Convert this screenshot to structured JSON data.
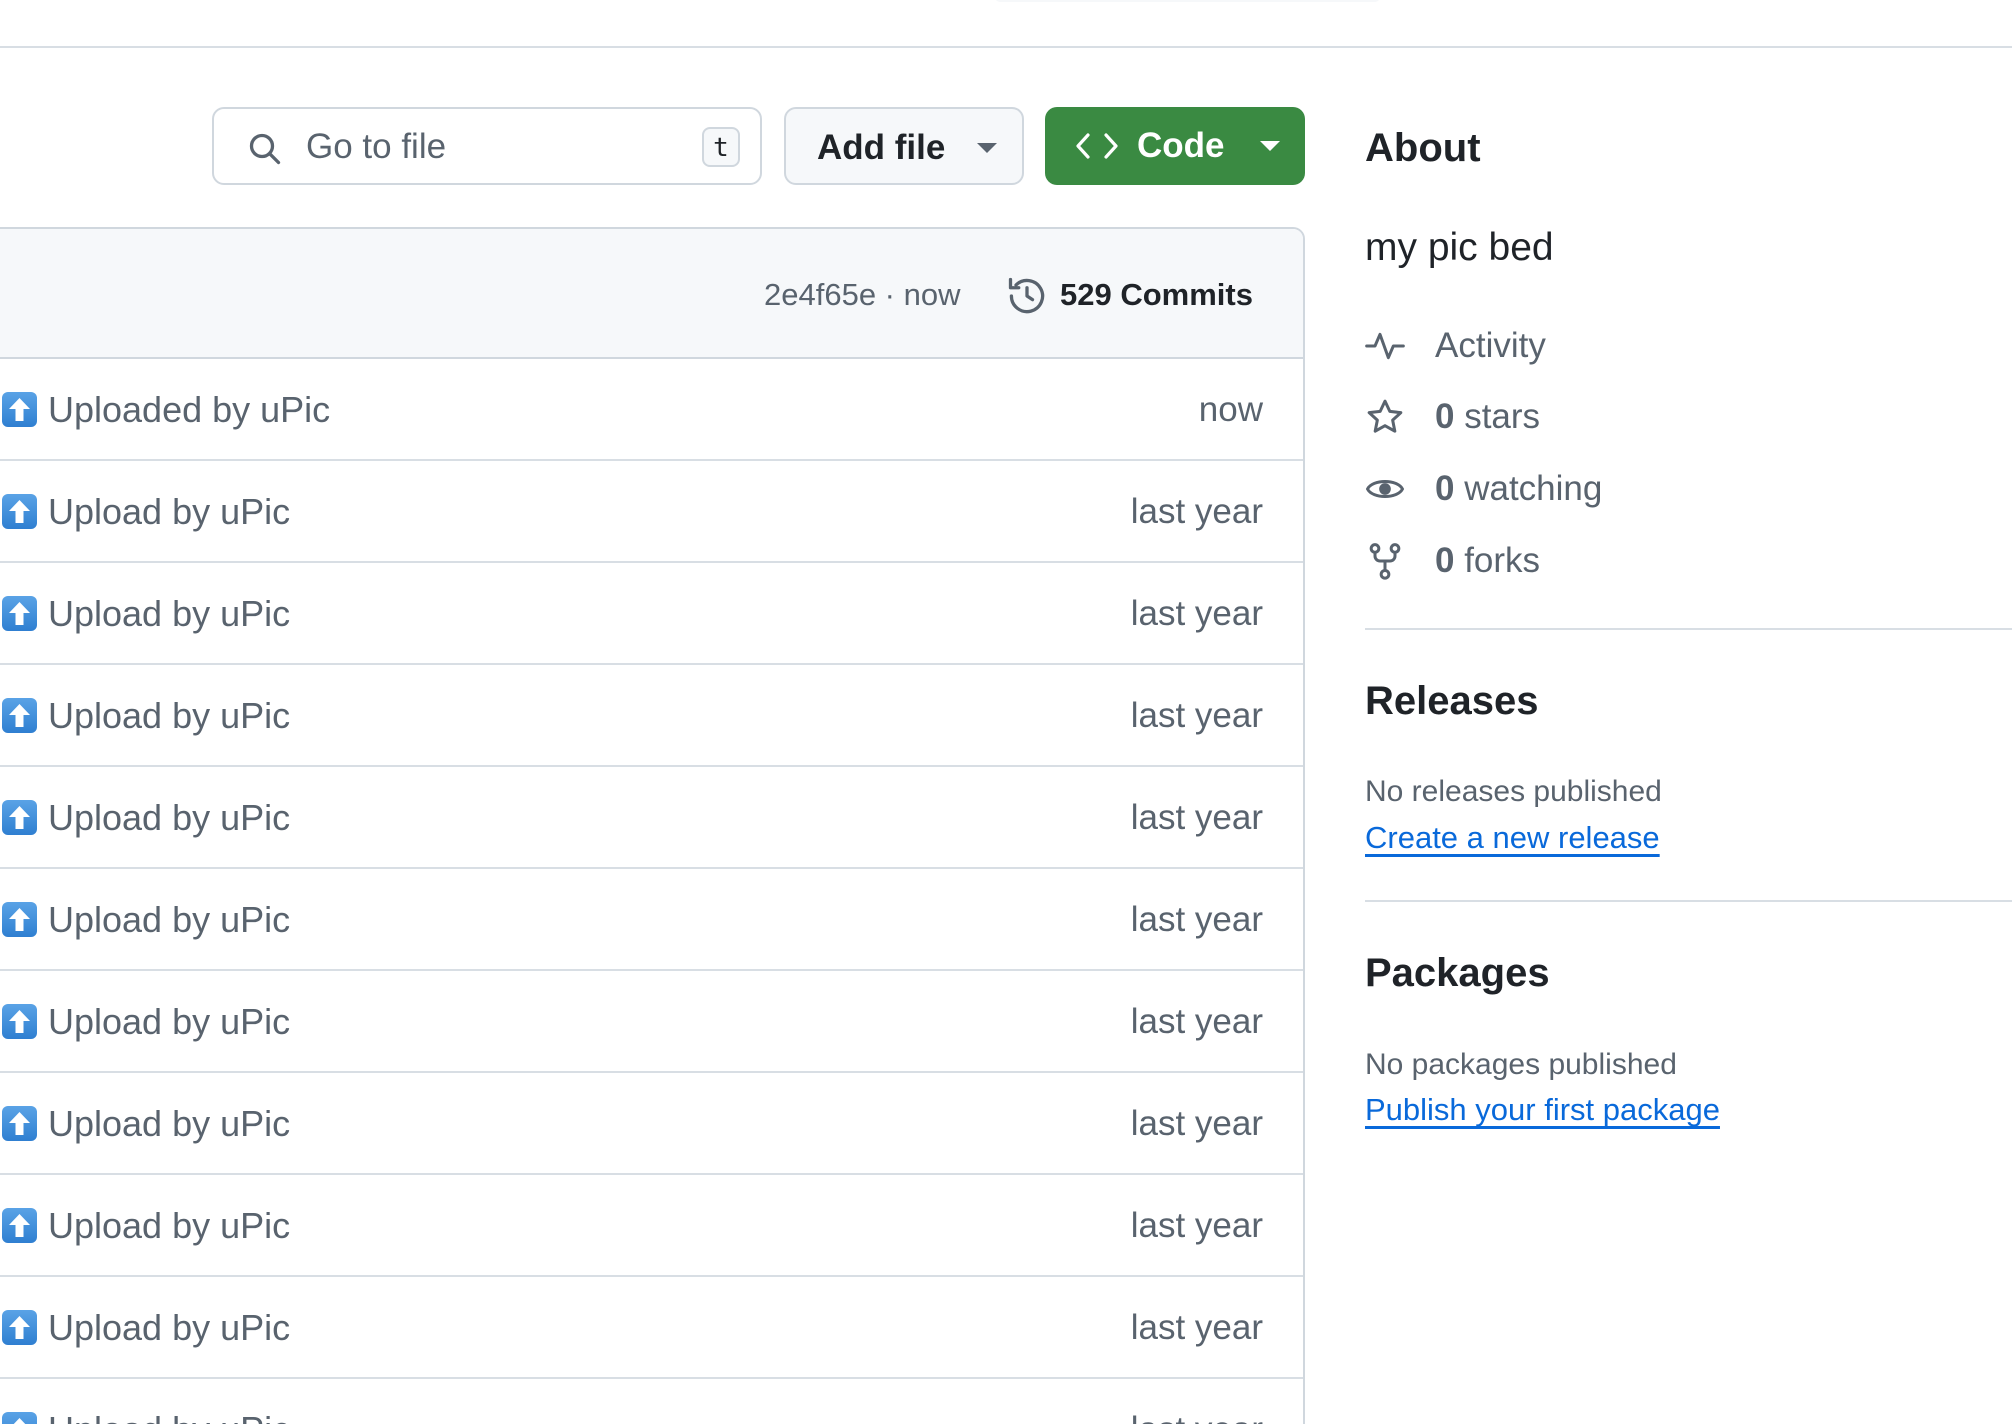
{
  "toolbar": {
    "search_placeholder": "Go to file",
    "search_shortcut": "t",
    "add_file_label": "Add file",
    "code_label": "Code",
    "code_button_color": "#3a8a42"
  },
  "commit_header": {
    "sha_time": "2e4f65e · now",
    "commits_label": "529 Commits"
  },
  "files": [
    {
      "icon": "arrow-up-emoji",
      "message": "Uploaded by uPic",
      "time": "now"
    },
    {
      "icon": "arrow-up-emoji",
      "message": "Upload by uPic",
      "time": "last year"
    },
    {
      "icon": "arrow-up-emoji",
      "message": "Upload by uPic",
      "time": "last year"
    },
    {
      "icon": "arrow-up-emoji",
      "message": "Upload by uPic",
      "time": "last year"
    },
    {
      "icon": "arrow-up-emoji",
      "message": "Upload by uPic",
      "time": "last year"
    },
    {
      "icon": "arrow-up-emoji",
      "message": "Upload by uPic",
      "time": "last year"
    },
    {
      "icon": "arrow-up-emoji",
      "message": "Upload by uPic",
      "time": "last year"
    },
    {
      "icon": "arrow-up-emoji",
      "message": "Upload by uPic",
      "time": "last year"
    },
    {
      "icon": "arrow-up-emoji",
      "message": "Upload by uPic",
      "time": "last year"
    },
    {
      "icon": "arrow-up-emoji",
      "message": "Upload by uPic",
      "time": "last year"
    },
    {
      "icon": "arrow-up-emoji",
      "message": "Upload by uPic",
      "time": "last year"
    }
  ],
  "about": {
    "title": "About",
    "description": "my pic bed",
    "activity_label": "Activity",
    "stars_count": "0",
    "stars_label": "stars",
    "watching_count": "0",
    "watching_label": "watching",
    "forks_count": "0",
    "forks_label": "forks"
  },
  "releases": {
    "title": "Releases",
    "empty_text": "No releases published",
    "link_text": "Create a new release"
  },
  "packages": {
    "title": "Packages",
    "empty_text": "No packages published",
    "link_text": "Publish your first package"
  },
  "colors": {
    "link": "#0969da",
    "muted": "#59636e",
    "border": "#d0d7de"
  }
}
